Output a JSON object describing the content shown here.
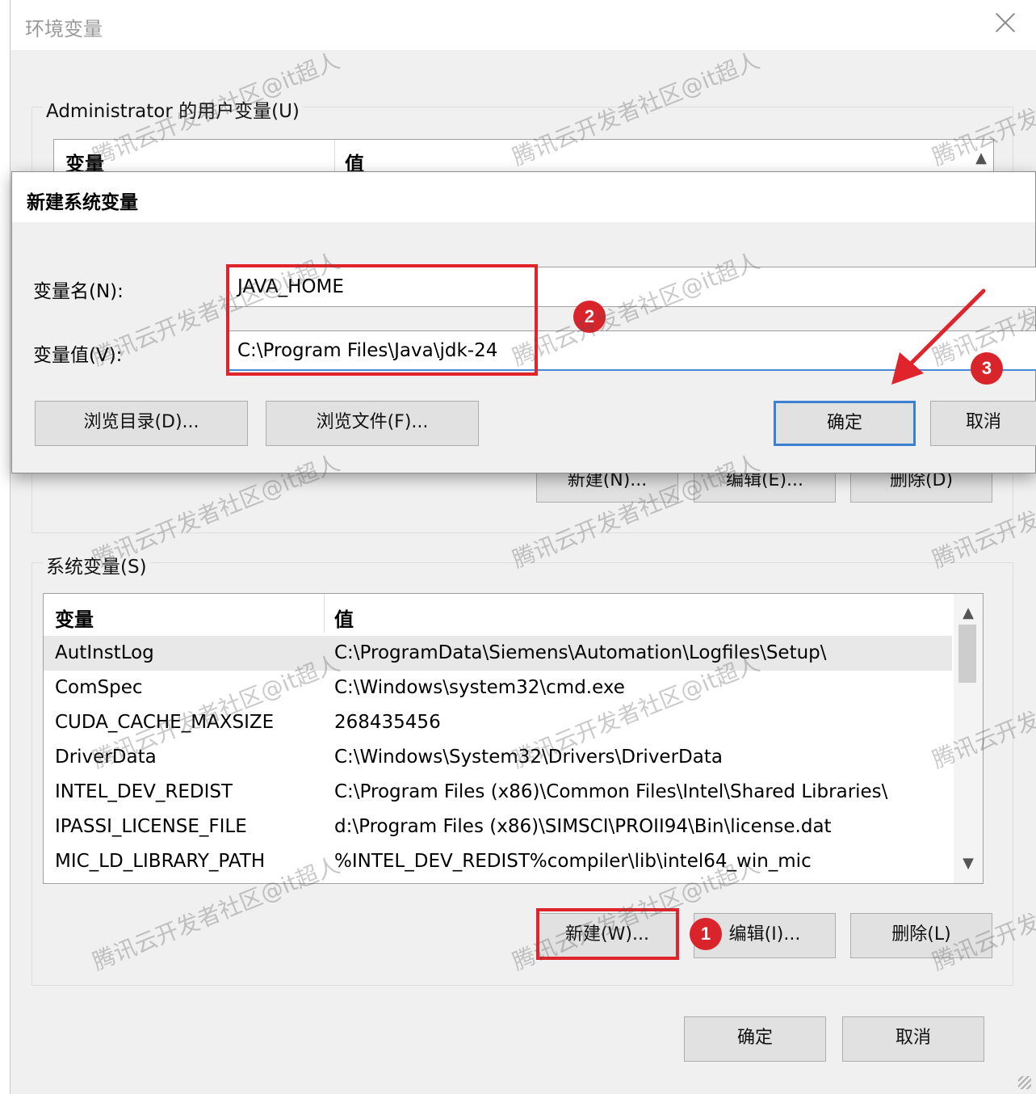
{
  "window": {
    "title": "环境变量"
  },
  "user_vars": {
    "group_label": "Administrator 的用户变量(U)",
    "col_var": "变量",
    "col_val": "值",
    "buttons": {
      "new": "新建(N)...",
      "edit": "编辑(E)...",
      "delete": "删除(D)"
    }
  },
  "dialog": {
    "title": "新建系统变量",
    "name_label": "变量名(N):",
    "name_value": "JAVA_HOME",
    "value_label": "变量值(V):",
    "value_value": "C:\\Program Files\\Java\\jdk-24",
    "browse_dir": "浏览目录(D)...",
    "browse_file": "浏览文件(F)...",
    "ok": "确定",
    "cancel": "取消"
  },
  "system_vars": {
    "group_label": "系统变量(S)",
    "col_var": "变量",
    "col_val": "值",
    "rows": [
      {
        "name": "AutInstLog",
        "value": "C:\\ProgramData\\Siemens\\Automation\\Logfiles\\Setup\\"
      },
      {
        "name": "ComSpec",
        "value": "C:\\Windows\\system32\\cmd.exe"
      },
      {
        "name": "CUDA_CACHE_MAXSIZE",
        "value": "268435456"
      },
      {
        "name": "DriverData",
        "value": "C:\\Windows\\System32\\Drivers\\DriverData"
      },
      {
        "name": "INTEL_DEV_REDIST",
        "value": "C:\\Program Files (x86)\\Common Files\\Intel\\Shared Libraries\\"
      },
      {
        "name": "IPASSI_LICENSE_FILE",
        "value": "d:\\Program Files (x86)\\SIMSCI\\PROII94\\Bin\\license.dat"
      },
      {
        "name": "MIC_LD_LIBRARY_PATH",
        "value": "%INTEL_DEV_REDIST%compiler\\lib\\intel64_win_mic"
      }
    ],
    "buttons": {
      "new": "新建(W)...",
      "edit": "编辑(I)...",
      "delete": "删除(L)"
    }
  },
  "footer": {
    "ok": "确定",
    "cancel": "取消"
  },
  "annotations": {
    "badge1": "1",
    "badge2": "2",
    "badge3": "3",
    "color": "#e0242b"
  },
  "watermark": "腾讯云开发者社区@it超人"
}
